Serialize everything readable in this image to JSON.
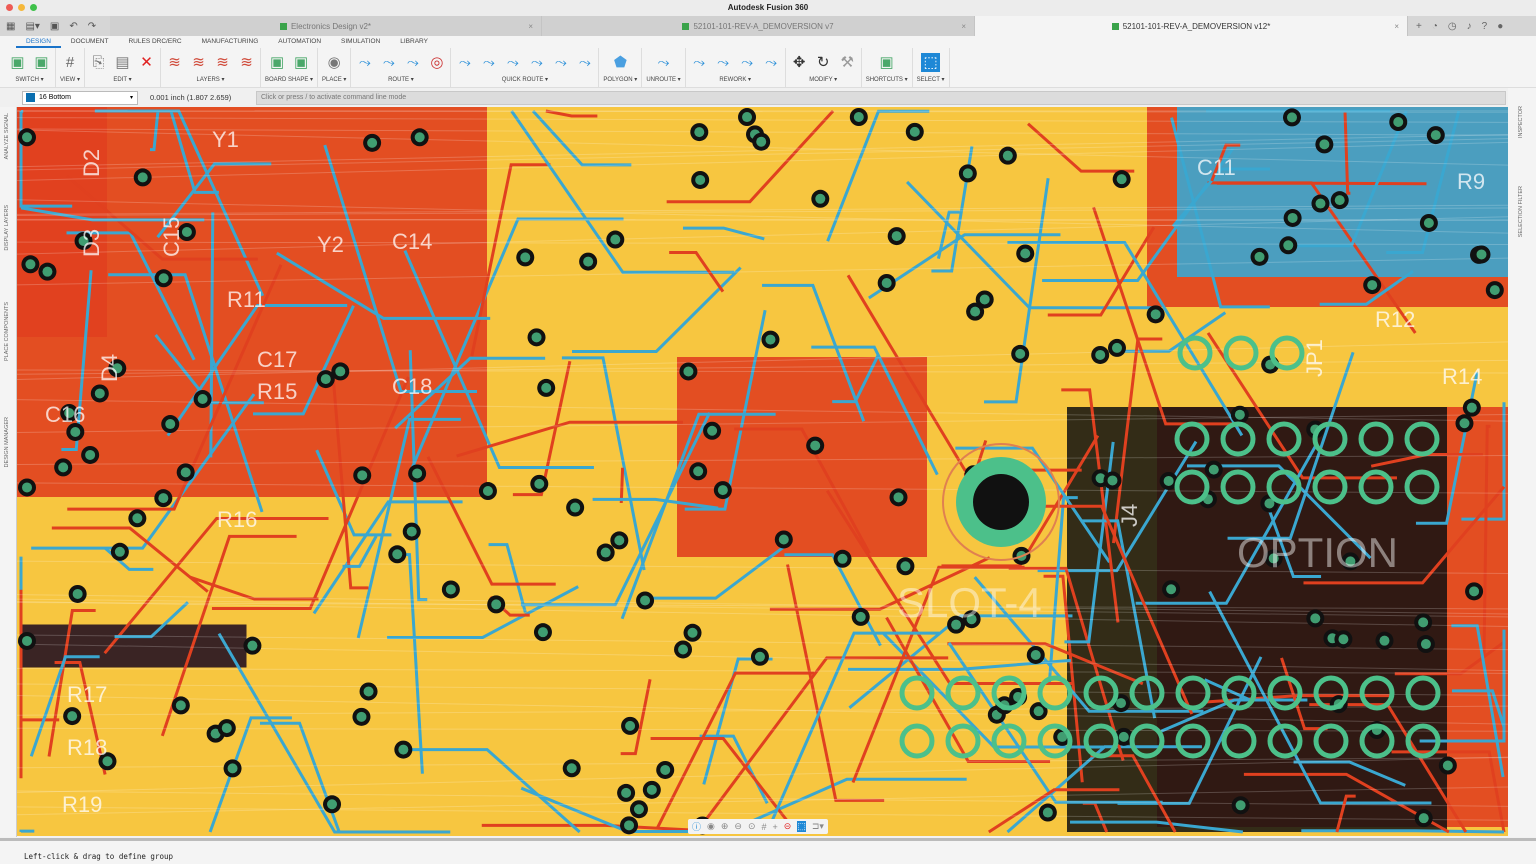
{
  "window": {
    "title": "Autodesk Fusion 360"
  },
  "tabs": [
    {
      "label": "Electronics Design v2*",
      "active": false
    },
    {
      "label": "52101-101-REV-A_DEMOVERSION v7",
      "active": false
    },
    {
      "label": "52101-101-REV-A_DEMOVERSION v12*",
      "active": true
    }
  ],
  "ribbon_tabs": [
    "DESIGN",
    "DOCUMENT",
    "RULES DRC/ERC",
    "MANUFACTURING",
    "AUTOMATION",
    "SIMULATION",
    "LIBRARY"
  ],
  "active_ribbon_tab": "DESIGN",
  "groups": [
    {
      "label": "SWITCH ▾",
      "icons": [
        "schematic-switch-icon",
        "board-3d-icon"
      ]
    },
    {
      "label": "VIEW ▾",
      "icons": [
        "grid-icon"
      ]
    },
    {
      "label": "EDIT ▾",
      "icons": [
        "copy-icon",
        "paste-icon",
        "delete-icon"
      ]
    },
    {
      "label": "LAYERS ▾",
      "icons": [
        "layers-top-icon",
        "layers-bottom-icon",
        "layers-inner-icon",
        "layer-stack-icon"
      ]
    },
    {
      "label": "BOARD SHAPE ▾",
      "icons": [
        "board-outline-icon",
        "board-shape-icon"
      ]
    },
    {
      "label": "PLACE ▾",
      "icons": [
        "place-component-icon"
      ]
    },
    {
      "label": "ROUTE ▾",
      "icons": [
        "route-icon",
        "fanout-icon",
        "multi-route-icon",
        "via-icon"
      ]
    },
    {
      "label": "QUICK ROUTE ▾",
      "icons": [
        "quick-route-icon",
        "quick-route-signal-icon",
        "quick-route-bus-icon",
        "quick-route-diff-icon",
        "quick-route-airwire-icon",
        "quick-route-all-icon"
      ]
    },
    {
      "label": "POLYGON ▾",
      "icons": [
        "polygon-icon"
      ]
    },
    {
      "label": "UNROUTE ▾",
      "icons": [
        "unroute-icon"
      ]
    },
    {
      "label": "REWORK ▾",
      "icons": [
        "miter-icon",
        "meander-icon",
        "slice-icon",
        "reroute-icon"
      ]
    },
    {
      "label": "MODIFY ▾",
      "icons": [
        "move-icon",
        "rotate-icon",
        "wrench-icon"
      ]
    },
    {
      "label": "SHORTCUTS ▾",
      "icons": [
        "shortcuts-icon"
      ]
    },
    {
      "label": "SELECT ▾",
      "icons": [
        "select-icon"
      ]
    }
  ],
  "command_bar": {
    "layer": "16 Bottom",
    "layer_color": "#0b6fb0",
    "coordinate": "0.001 inch (1.807 2.659)",
    "placeholder": "Click or press / to activate command line mode"
  },
  "left_panels": [
    "ANALYZE SIGNAL",
    "DISPLAY LAYERS",
    "PLACE COMPONENTS",
    "DESIGN MANAGER"
  ],
  "right_panels": [
    "INSPECTOR",
    "SELECTION FILTER"
  ],
  "board_labels": [
    {
      "t": "Y1"
    },
    {
      "t": "D2"
    },
    {
      "t": "D3"
    },
    {
      "t": "C15"
    },
    {
      "t": "Y2"
    },
    {
      "t": "C14"
    },
    {
      "t": "R11"
    },
    {
      "t": "C17"
    },
    {
      "t": "R15"
    },
    {
      "t": "C18"
    },
    {
      "t": "D4"
    },
    {
      "t": "C16"
    },
    {
      "t": "R16"
    },
    {
      "t": "R17"
    },
    {
      "t": "R18"
    },
    {
      "t": "R19"
    },
    {
      "t": "C11"
    },
    {
      "t": "R9"
    },
    {
      "t": "R12"
    },
    {
      "t": "JP1"
    },
    {
      "t": "J4"
    },
    {
      "t": "OPTION"
    },
    {
      "t": "SLOT-4"
    },
    {
      "t": "R14"
    }
  ],
  "colors": {
    "board": "#f7c640",
    "top_copper": "#e0401f",
    "bottom_copper": "#3aa7d0",
    "via": "#111111",
    "pad": "#4cc08a"
  },
  "nav_icons": [
    "info-icon",
    "eye-icon",
    "zoom-in-icon",
    "zoom-out-icon",
    "zoom-fit-icon",
    "grid-icon",
    "crosshair-icon",
    "stop-icon",
    "select-mode-icon",
    "route-mode-icon"
  ],
  "status": "Left-click & drag to define group"
}
